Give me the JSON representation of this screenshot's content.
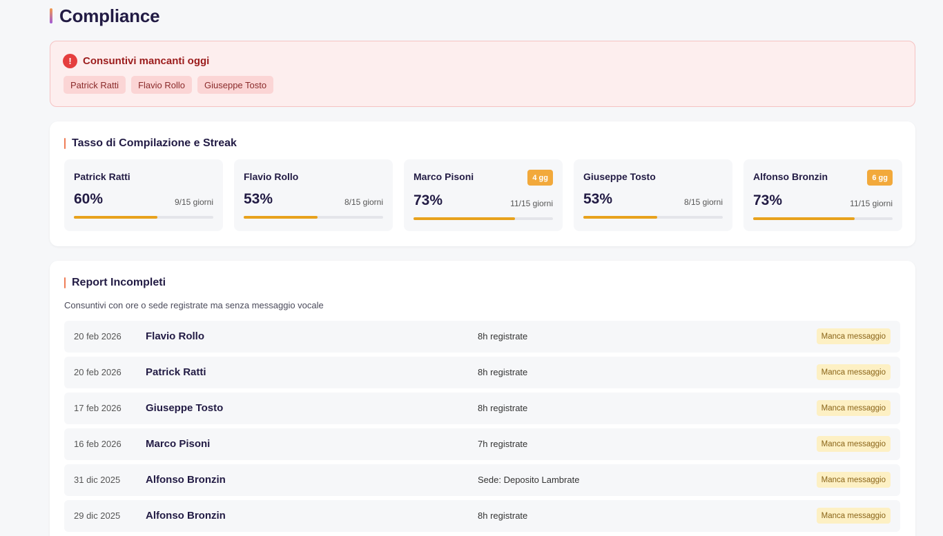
{
  "page": {
    "title": "Compliance"
  },
  "alert": {
    "icon": "alert-circle-icon",
    "title": "Consuntivi mancanti oggi",
    "people": [
      "Patrick Ratti",
      "Flavio Rollo",
      "Giuseppe Tosto"
    ]
  },
  "rate": {
    "title": "Tasso di Compilazione e Streak",
    "people": [
      {
        "name": "Patrick Ratti",
        "pct": "60%",
        "days": "9/15 giorni",
        "progress": 0.6,
        "badge": ""
      },
      {
        "name": "Flavio Rollo",
        "pct": "53%",
        "days": "8/15 giorni",
        "progress": 0.53,
        "badge": ""
      },
      {
        "name": "Marco Pisoni",
        "pct": "73%",
        "days": "11/15 giorni",
        "progress": 0.73,
        "badge": "4 gg"
      },
      {
        "name": "Giuseppe Tosto",
        "pct": "53%",
        "days": "8/15 giorni",
        "progress": 0.53,
        "badge": ""
      },
      {
        "name": "Alfonso Bronzin",
        "pct": "73%",
        "days": "11/15 giorni",
        "progress": 0.73,
        "badge": "6 gg"
      }
    ]
  },
  "reports": {
    "title": "Report Incompleti",
    "subtitle": "Consuntivi con ore o sede registrate ma senza messaggio vocale",
    "rows": [
      {
        "date": "20 feb 2026",
        "name": "Flavio Rollo",
        "info": "8h registrate",
        "badge": "Manca messaggio"
      },
      {
        "date": "20 feb 2026",
        "name": "Patrick Ratti",
        "info": "8h registrate",
        "badge": "Manca messaggio"
      },
      {
        "date": "17 feb 2026",
        "name": "Giuseppe Tosto",
        "info": "8h registrate",
        "badge": "Manca messaggio"
      },
      {
        "date": "16 feb 2026",
        "name": "Marco Pisoni",
        "info": "7h registrate",
        "badge": "Manca messaggio"
      },
      {
        "date": "31 dic 2025",
        "name": "Alfonso Bronzin",
        "info": "Sede: Deposito Lambrate",
        "badge": "Manca messaggio"
      },
      {
        "date": "29 dic 2025",
        "name": "Alfonso Bronzin",
        "info": "8h registrate",
        "badge": "Manca messaggio"
      }
    ]
  },
  "colors": {
    "accent": "#e8a21d",
    "alert_bg": "#fdeeee",
    "alert_text": "#9b1c1c",
    "badge_orange": "#f2a93b",
    "badge_yellow": "#fdf0c4"
  }
}
